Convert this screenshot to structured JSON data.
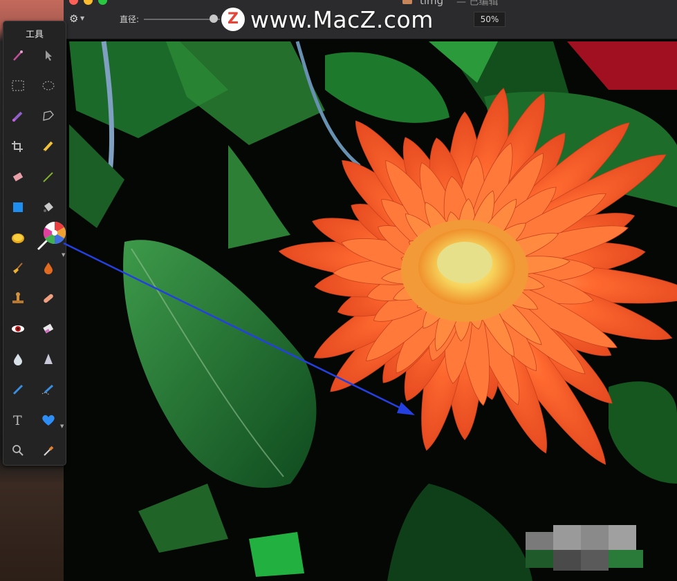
{
  "window": {
    "title": "timg",
    "edited": "— 已编辑",
    "traffic": {
      "close": "#fe5f57",
      "minimize": "#febc2e",
      "zoom": "#28c840"
    }
  },
  "toolbar": {
    "gear_icon": "gear-icon",
    "radius_label": "直径:",
    "radius_value": 0.92,
    "zoom_value": "50%"
  },
  "watermark": {
    "logo_letter": "Z",
    "text": "www.MacZ.com"
  },
  "tools_panel": {
    "title": "工具",
    "tools": [
      {
        "name": "magic-wand-icon"
      },
      {
        "name": "arrow-select-icon"
      },
      {
        "name": "rect-select-icon"
      },
      {
        "name": "ellipse-select-icon"
      },
      {
        "name": "color-select-brush-icon"
      },
      {
        "name": "lasso-icon"
      },
      {
        "name": "crop-icon"
      },
      {
        "name": "pencil-icon"
      },
      {
        "name": "eraser-icon"
      },
      {
        "name": "brush-line-icon"
      },
      {
        "name": "shape-icon"
      },
      {
        "name": "paint-bucket-icon"
      },
      {
        "name": "coin-icon"
      },
      {
        "name": "lollipop-icon"
      },
      {
        "name": "broom-icon"
      },
      {
        "name": "drop-icon"
      },
      {
        "name": "stamp-icon"
      },
      {
        "name": "bandage-icon"
      },
      {
        "name": "red-eye-icon"
      },
      {
        "name": "smudge-icon"
      },
      {
        "name": "water-drop-icon"
      },
      {
        "name": "sharpen-cone-icon"
      },
      {
        "name": "pen-icon"
      },
      {
        "name": "bezier-pen-icon"
      },
      {
        "name": "text-icon"
      },
      {
        "name": "heart-shape-icon"
      },
      {
        "name": "zoom-icon"
      },
      {
        "name": "eyedropper-icon"
      }
    ]
  },
  "colors": {
    "accent_arrow": "#2440e0",
    "panel_bg": "#232324"
  }
}
